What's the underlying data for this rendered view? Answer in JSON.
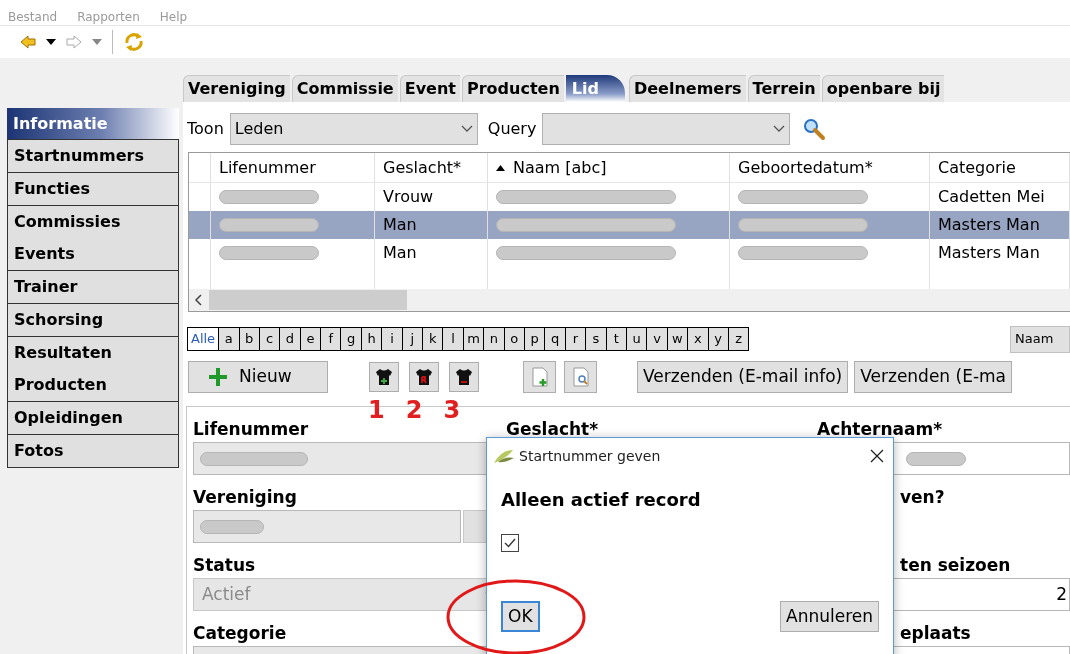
{
  "menu": [
    "Bestand",
    "Rapporten",
    "Help"
  ],
  "tabs": [
    {
      "label": "Vereniging",
      "selected": false
    },
    {
      "label": "Commissie",
      "selected": false
    },
    {
      "label": "Event",
      "selected": false
    },
    {
      "label": "Producten",
      "selected": false
    },
    {
      "label": "Lid",
      "selected": true
    },
    {
      "label": "Deelnemers",
      "selected": false
    },
    {
      "label": "Terrein",
      "selected": false
    },
    {
      "label": "openbare bij",
      "selected": false
    }
  ],
  "sidebar": {
    "groups": [
      {
        "items": [
          {
            "label": "Informatie",
            "selected": true
          }
        ]
      },
      {
        "items": [
          {
            "label": "Startnummers",
            "selected": false
          }
        ]
      },
      {
        "items": [
          {
            "label": "Functies",
            "selected": false
          }
        ]
      },
      {
        "items": [
          {
            "label": "Commissies",
            "selected": false
          },
          {
            "label": "Events",
            "selected": false
          }
        ]
      },
      {
        "items": [
          {
            "label": "Trainer",
            "selected": false
          }
        ]
      },
      {
        "items": [
          {
            "label": "Schorsing",
            "selected": false
          }
        ]
      },
      {
        "items": [
          {
            "label": "Resultaten",
            "selected": false
          },
          {
            "label": "Producten",
            "selected": false
          }
        ]
      },
      {
        "items": [
          {
            "label": "Opleidingen",
            "selected": false
          }
        ]
      },
      {
        "items": [
          {
            "label": "Fotos",
            "selected": false
          }
        ]
      }
    ]
  },
  "filter": {
    "toon_label": "Toon",
    "toon_value": "Leden",
    "query_label": "Query"
  },
  "table": {
    "columns": [
      {
        "label": "Lifenummer",
        "sorted": false
      },
      {
        "label": "Geslacht*",
        "sorted": false
      },
      {
        "label": "Naam [abc]",
        "sorted": true
      },
      {
        "label": "Geboortedatum*",
        "sorted": false
      },
      {
        "label": "Categorie",
        "sorted": false
      }
    ],
    "rows": [
      {
        "selected": false,
        "cells": [
          {
            "kind": "redacted"
          },
          {
            "kind": "text",
            "text": "Vrouw"
          },
          {
            "kind": "redacted"
          },
          {
            "kind": "redacted"
          },
          {
            "kind": "text",
            "text": "Cadetten Mei"
          }
        ]
      },
      {
        "selected": true,
        "cells": [
          {
            "kind": "redacted"
          },
          {
            "kind": "text",
            "text": "Man"
          },
          {
            "kind": "redacted"
          },
          {
            "kind": "redacted"
          },
          {
            "kind": "text",
            "text": "Masters Man"
          }
        ]
      },
      {
        "selected": false,
        "cells": [
          {
            "kind": "redacted"
          },
          {
            "kind": "text",
            "text": "Man"
          },
          {
            "kind": "redacted"
          },
          {
            "kind": "redacted"
          },
          {
            "kind": "text",
            "text": "Masters Man"
          }
        ]
      }
    ]
  },
  "letters": [
    {
      "label": "Alle",
      "selected": true
    },
    {
      "label": "a",
      "selected": false
    },
    {
      "label": "b",
      "selected": false
    },
    {
      "label": "c",
      "selected": false
    },
    {
      "label": "d",
      "selected": false
    },
    {
      "label": "e",
      "selected": false
    },
    {
      "label": "f",
      "selected": false
    },
    {
      "label": "g",
      "selected": false
    },
    {
      "label": "h",
      "selected": false
    },
    {
      "label": "i",
      "selected": false
    },
    {
      "label": "j",
      "selected": false
    },
    {
      "label": "k",
      "selected": false
    },
    {
      "label": "l",
      "selected": false
    },
    {
      "label": "m",
      "selected": false
    },
    {
      "label": "n",
      "selected": false
    },
    {
      "label": "o",
      "selected": false
    },
    {
      "label": "p",
      "selected": false
    },
    {
      "label": "q",
      "selected": false
    },
    {
      "label": "r",
      "selected": false
    },
    {
      "label": "s",
      "selected": false
    },
    {
      "label": "t",
      "selected": false
    },
    {
      "label": "u",
      "selected": false
    },
    {
      "label": "v",
      "selected": false
    },
    {
      "label": "w",
      "selected": false
    },
    {
      "label": "x",
      "selected": false
    },
    {
      "label": "y",
      "selected": false
    },
    {
      "label": "z",
      "selected": false
    }
  ],
  "sort_field": "Naam",
  "new_button": "Nieuw",
  "send_buttons": [
    "Verzenden (E-mail info)",
    "Verzenden (E-ma"
  ],
  "annotation_numbers": [
    "1",
    "2",
    "3"
  ],
  "form": {
    "left": [
      {
        "label": "Lifenummer",
        "kind": "redacted"
      },
      {
        "label": "Vereniging",
        "kind": "redacted_lookup"
      },
      {
        "label": "Status",
        "kind": "select",
        "value": "Actief",
        "disabled": true
      },
      {
        "label": "Categorie",
        "kind": "field"
      }
    ],
    "middle": [
      {
        "label": "Geslacht*"
      }
    ],
    "right": [
      {
        "label": "Achternaam*",
        "kind": "redacted"
      },
      {
        "label": "ven?",
        "kind": "label"
      },
      {
        "label": "ten seizoen",
        "kind": "number",
        "value": "2"
      },
      {
        "label": "eplaats",
        "kind": "field"
      }
    ]
  },
  "dialog": {
    "title": "Startnummer geven",
    "heading": "Alleen actief record",
    "checked": true,
    "buttons": [
      {
        "label": "OK",
        "focused": true
      },
      {
        "label": "Annuleren",
        "focused": false
      }
    ]
  }
}
